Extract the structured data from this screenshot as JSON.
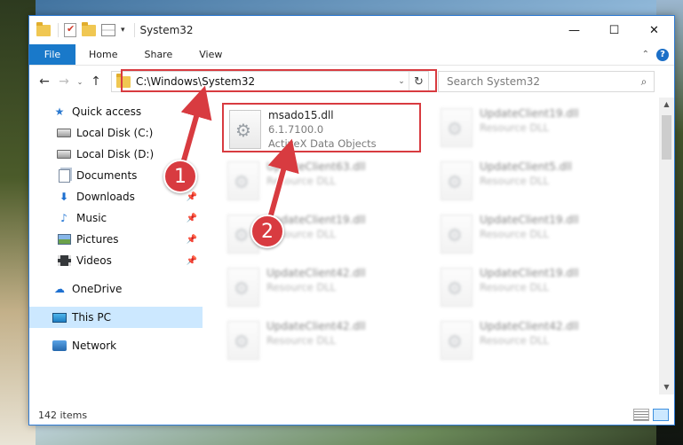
{
  "window": {
    "title": "System32",
    "controls": {
      "minimize": "—",
      "maximize": "☐",
      "close": "✕"
    }
  },
  "ribbon": {
    "tabs": [
      "File",
      "Home",
      "Share",
      "View"
    ],
    "collapse_glyph": "⌃",
    "help_glyph": "?"
  },
  "navigation": {
    "back_glyph": "←",
    "forward_glyph": "→",
    "recent_glyph": "⌄",
    "up_glyph": "↑",
    "address_path": "C:\\Windows\\System32",
    "address_dropdown_glyph": "⌄",
    "refresh_glyph": "↻",
    "search_placeholder": "Search System32",
    "search_icon_glyph": "⌕"
  },
  "sidebar": {
    "items": [
      {
        "label": "Quick access",
        "icon": "star-icon"
      },
      {
        "label": "Local Disk (C:)",
        "icon": "drive-icon"
      },
      {
        "label": "Local Disk (D:)",
        "icon": "drive-icon"
      },
      {
        "label": "Documents",
        "icon": "documents-icon"
      },
      {
        "label": "Downloads",
        "icon": "download-icon",
        "pinned": true
      },
      {
        "label": "Music",
        "icon": "music-icon",
        "pinned": true
      },
      {
        "label": "Pictures",
        "icon": "pictures-icon",
        "pinned": true
      },
      {
        "label": "Videos",
        "icon": "videos-icon",
        "pinned": true
      },
      {
        "label": "OneDrive",
        "icon": "cloud-icon"
      },
      {
        "label": "This PC",
        "icon": "computer-icon",
        "selected": true
      },
      {
        "label": "Network",
        "icon": "network-icon"
      }
    ],
    "pin_glyph": "📌"
  },
  "files": [
    {
      "name": "msado15.dll",
      "line2": "6.1.7100.0",
      "line3": "ActiveX Data Objects",
      "highlighted": true
    },
    {
      "name": "UpdateClient19.dll",
      "line2": "Resource DLL"
    },
    {
      "name": "UpdateClient63.dll",
      "line2": "Resource DLL"
    },
    {
      "name": "UpdateClient5.dll",
      "line2": "Resource DLL"
    },
    {
      "name": "UpdateClient19.dll",
      "line2": "Resource DLL"
    },
    {
      "name": "UpdateClient19.dll",
      "line2": "Resource DLL"
    },
    {
      "name": "UpdateClient42.dll",
      "line2": "Resource DLL"
    },
    {
      "name": "UpdateClient19.dll",
      "line2": "Resource DLL"
    },
    {
      "name": "UpdateClient42.dll",
      "line2": "Resource DLL"
    },
    {
      "name": "UpdateClient42.dll",
      "line2": "Resource DLL"
    }
  ],
  "status": {
    "item_count": "142 items"
  },
  "annotations": {
    "step1": "1",
    "step2": "2",
    "color": "#d83b40"
  },
  "colors": {
    "file_tab": "#1979ca",
    "selection": "#cce8ff",
    "accent_border": "#2f7bd4"
  }
}
